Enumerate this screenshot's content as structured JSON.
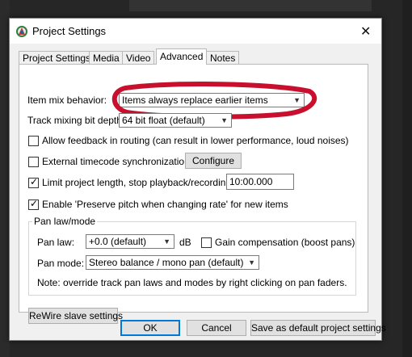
{
  "window": {
    "title": "Project Settings",
    "close_glyph": "✕"
  },
  "tabs": [
    {
      "label": "Project Settings",
      "active": false
    },
    {
      "label": "Media",
      "active": false
    },
    {
      "label": "Video",
      "active": false
    },
    {
      "label": "Advanced",
      "active": true
    },
    {
      "label": "Notes",
      "active": false
    }
  ],
  "advanced": {
    "item_mix": {
      "label": "Item mix behavior:",
      "value": "Items always replace earlier items"
    },
    "bit_depth": {
      "label": "Track mixing bit depth:",
      "value": "64 bit float (default)"
    },
    "allow_feedback": {
      "label": "Allow feedback in routing (can result in lower performance, loud noises)",
      "checked": false
    },
    "ext_timecode": {
      "label": "External timecode synchronization",
      "checked": false,
      "configure_label": "Configure"
    },
    "limit_length": {
      "label": "Limit project length, stop playback/recording at:",
      "checked": true,
      "value": "10:00.000"
    },
    "preserve_pitch": {
      "label": "Enable 'Preserve pitch when changing rate' for new items",
      "checked": true
    },
    "pan": {
      "group_label": "Pan law/mode",
      "law_label": "Pan law:",
      "law_value": "+0.0 (default)",
      "law_unit": "dB",
      "gain_comp_label": "Gain compensation (boost pans)",
      "gain_comp_checked": false,
      "mode_label": "Pan mode:",
      "mode_value": "Stereo balance / mono pan (default)",
      "note": "Note: override track pan laws and modes by right clicking on pan faders."
    },
    "rewire_label": "ReWire slave settings"
  },
  "footer": {
    "ok_label": "OK",
    "cancel_label": "Cancel",
    "save_default_label": "Save as default project settings"
  },
  "icons": {
    "app": "reaper-logo-icon",
    "check": "✓",
    "dropdown": "▼"
  },
  "colors": {
    "annotation": "#c8102e",
    "focus": "#0078d7",
    "background": "#262626"
  }
}
